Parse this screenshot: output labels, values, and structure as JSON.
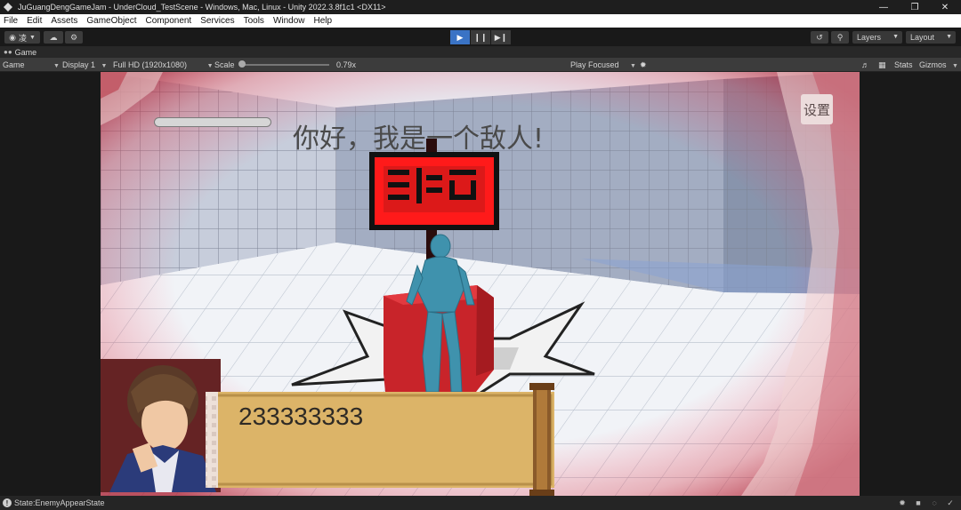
{
  "window": {
    "title": "JuGuangDengGameJam - UnderCloud_TestScene - Windows, Mac, Linux - Unity 2022.3.8f1c1 <DX11>",
    "controls": [
      "minimize-icon",
      "restore-icon",
      "close-icon"
    ]
  },
  "menu": {
    "items": [
      "File",
      "Edit",
      "Assets",
      "GameObject",
      "Component",
      "Services",
      "Tools",
      "Window",
      "Help"
    ]
  },
  "toolbar": {
    "account_label": "凌",
    "layers_label": "Layers",
    "layout_label": "Layout",
    "play_state": "playing",
    "accent_color": "#3a73c5"
  },
  "game_tab": {
    "label": "Game"
  },
  "game_view": {
    "mode_label": "Game",
    "display_label": "Display 1",
    "resolution_label": "Full HD (1920x1080)",
    "scale_label": "Scale",
    "scale_value": "0.79x",
    "play_focused_label": "Play Focused",
    "stats_label": "Stats",
    "gizmos_label": "Gizmos"
  },
  "scene": {
    "greeting_text": "你好，我是一个敌人!",
    "settings_label": "设置",
    "dialog_text": "233333333",
    "sign_color": "#ff1a1a",
    "box_color": "#c8242a",
    "scroll_color": "#dcb468"
  },
  "status": {
    "text": "State:EnemyAppearState"
  }
}
